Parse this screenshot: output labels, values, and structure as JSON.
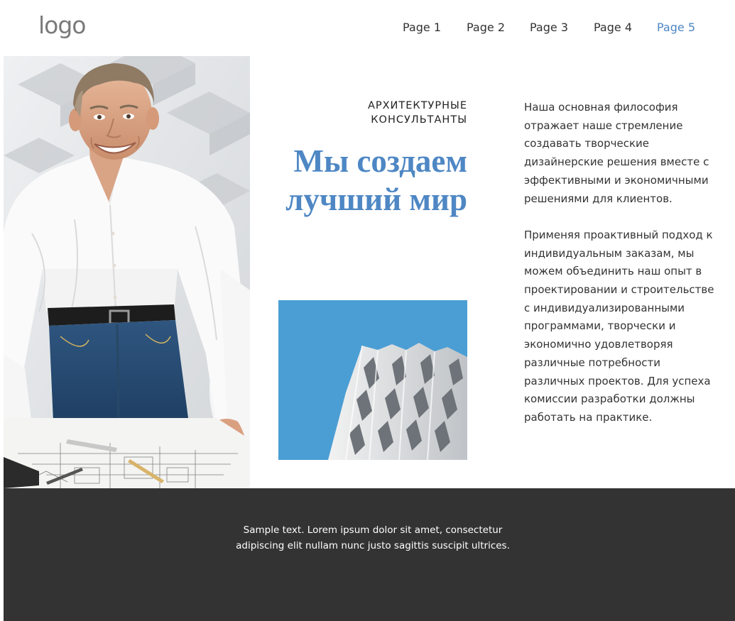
{
  "header": {
    "logo": "logo",
    "nav": [
      {
        "label": "Page 1",
        "active": false
      },
      {
        "label": "Page 2",
        "active": false
      },
      {
        "label": "Page 3",
        "active": false
      },
      {
        "label": "Page 4",
        "active": false
      },
      {
        "label": "Page 5",
        "active": true
      }
    ]
  },
  "hero": {
    "kicker": "АРХИТЕКТУРНЫЕ КОНСУЛЬТАНТЫ",
    "headline": "Мы создаем лучший мир",
    "paragraphs": [
      "Наша основная философия отражает наше стремление создавать творческие дизайнерские решения вместе с эффективными и экономичными решениями для клиентов.",
      "Применяя проактивный подход к индивидуальным заказам, мы можем объединить наш опыт в проектировании и строительстве с индивидуализированными программами, творчески и экономично удовлетворяя различные потребности различных проектов. Для успеха комиссии разработки должны работать на практике."
    ]
  },
  "footer": {
    "text": "Sample text. Lorem ipsum dolor sit amet, consectetur adipiscing elit nullam nunc justo sagittis suscipit ultrices."
  },
  "colors": {
    "accent": "#4e87c4",
    "footer_bg": "#333333",
    "sky": "#4a9ed4"
  }
}
